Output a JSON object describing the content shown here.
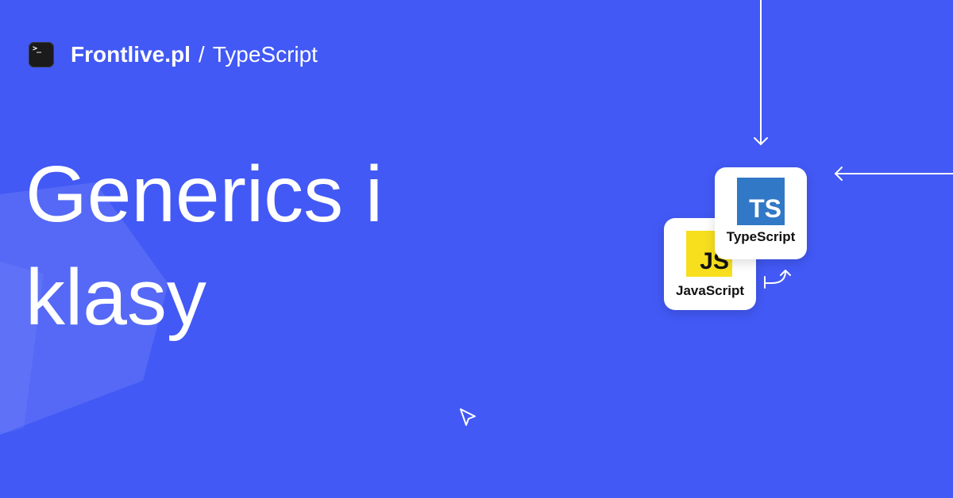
{
  "header": {
    "brand": "Frontlive.pl",
    "separator": "/",
    "section": "TypeScript",
    "icon_glyph": ">_"
  },
  "headline": {
    "line1": "Generics i",
    "line2": "klasy"
  },
  "cards": {
    "javascript": {
      "logo_text": "JS",
      "label": "JavaScript"
    },
    "typescript": {
      "logo_text": "TS",
      "label": "TypeScript"
    }
  },
  "colors": {
    "background": "#4259F5",
    "js_yellow": "#F7DF1E",
    "ts_blue": "#3178C6"
  },
  "icons": [
    "terminal-icon",
    "arrow-down-icon",
    "arrow-left-icon",
    "curved-arrow-icon",
    "cursor-icon"
  ]
}
